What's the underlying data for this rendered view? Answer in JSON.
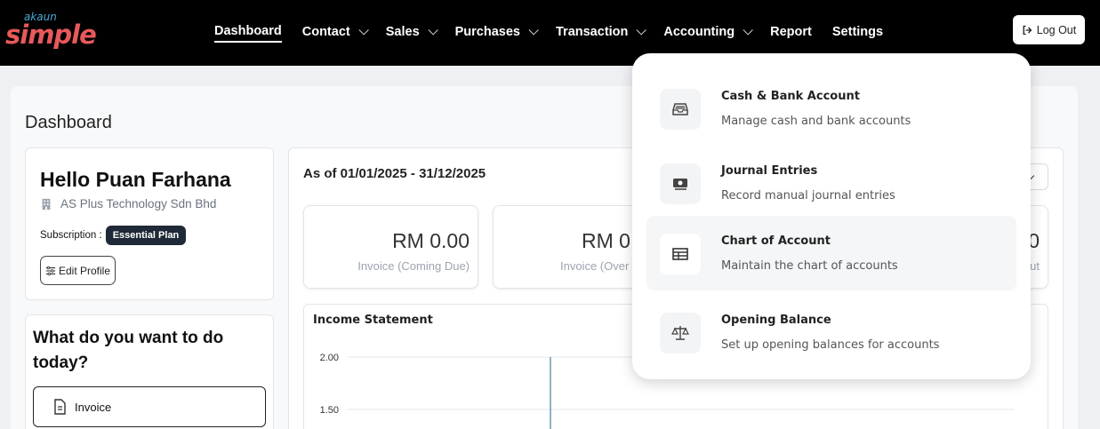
{
  "app": {
    "logo_small": "akaun",
    "logo_big": "simple"
  },
  "nav": {
    "items": [
      {
        "label": "Dashboard",
        "active": true,
        "has_menu": false
      },
      {
        "label": "Contact",
        "has_menu": true
      },
      {
        "label": "Sales",
        "has_menu": true
      },
      {
        "label": "Purchases",
        "has_menu": true
      },
      {
        "label": "Transaction",
        "has_menu": true
      },
      {
        "label": "Accounting",
        "has_menu": true
      },
      {
        "label": "Report",
        "has_menu": false
      },
      {
        "label": "Settings",
        "has_menu": false
      }
    ],
    "logout_label": "Log Out"
  },
  "page": {
    "title": "Dashboard"
  },
  "profile": {
    "greeting": "Hello Puan Farhana",
    "company": "AS Plus Technology Sdn Bhd",
    "subscription_label": "Subscription :",
    "plan": "Essential Plan",
    "edit_label": "Edit Profile"
  },
  "todo": {
    "title": "What do you want to do today?",
    "invoice_label": "Invoice"
  },
  "stats": {
    "period": "As of 01/01/2025 - 31/12/2025",
    "cards": [
      {
        "amount": "RM 0.00",
        "label": "Invoice (Coming Due)"
      },
      {
        "amount": "RM 0",
        "label": "Invoice (Over"
      },
      {
        "amount": "0",
        "label": "ut"
      }
    ]
  },
  "chart_data": {
    "type": "line",
    "title": "Income Statement",
    "y_ticks": [
      "2.00",
      "1.50"
    ],
    "ylim": [
      1.5,
      2.0
    ],
    "grid": true
  },
  "accounting_menu": [
    {
      "title": "Cash & Bank Account",
      "desc": "Manage cash and bank accounts",
      "icon": "inbox-tray-icon"
    },
    {
      "title": "Journal Entries",
      "desc": "Record manual journal entries",
      "icon": "money-bill-icon"
    },
    {
      "title": "Chart of Account",
      "desc": "Maintain the chart of accounts",
      "icon": "table-icon"
    },
    {
      "title": "Opening Balance",
      "desc": "Set up opening balances for accounts",
      "icon": "scale-balance-icon"
    }
  ],
  "colors": {
    "nav_bg": "#000000",
    "logo_red": "#e8595a",
    "logo_blue": "#4aa8d8",
    "plan_badge": "#1f2937",
    "chart_line": "#4a7fa8"
  }
}
